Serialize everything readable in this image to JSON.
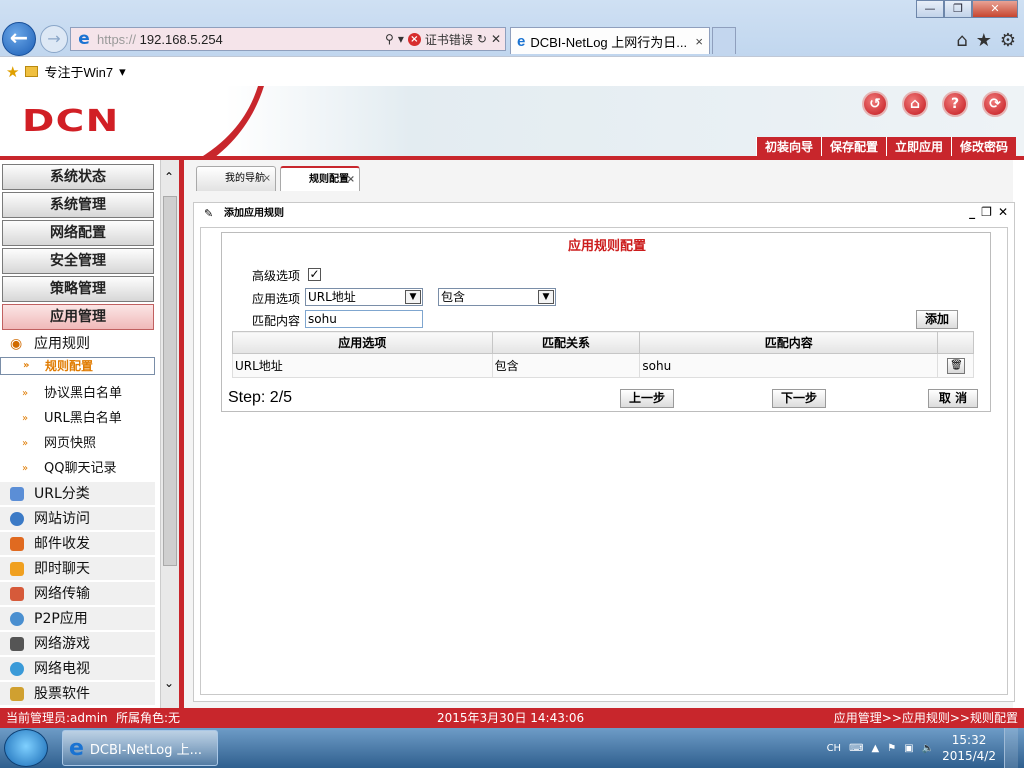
{
  "browser": {
    "url_scheme": "https://",
    "url_host": "192.168.5.254",
    "cert_error": "证书错误",
    "tab_title": "DCBI-NetLog 上网行为日...",
    "fav_item": "专注于Win7"
  },
  "app": {
    "logo": "DCN",
    "top_menu": [
      "初装向导",
      "保存配置",
      "立即应用",
      "修改密码"
    ]
  },
  "sidebar": {
    "groups": [
      "系统状态",
      "系统管理",
      "网络配置",
      "安全管理",
      "策略管理",
      "应用管理"
    ],
    "app_rule_header": "应用规则",
    "sub_items": [
      "规则配置",
      "协议黑白名单",
      "URL黑白名单",
      "网页快照",
      "QQ聊天记录"
    ],
    "categories": [
      "URL分类",
      "网站访问",
      "邮件收发",
      "即时聊天",
      "网络传输",
      "P2P应用",
      "网络游戏",
      "网络电视",
      "股票软件"
    ]
  },
  "tabs": [
    "我的导航",
    "规则配置"
  ],
  "panel": {
    "title": "添加应用规则",
    "form_title": "应用规则配置",
    "advanced_label": "高级选项",
    "app_option_label": "应用选项",
    "app_option_value": "URL地址",
    "relation_value": "包含",
    "match_label": "匹配内容",
    "match_value": "sohu",
    "add_button": "添加",
    "table_headers": [
      "应用选项",
      "匹配关系",
      "匹配内容"
    ],
    "rows": [
      {
        "option": "URL地址",
        "relation": "包含",
        "content": "sohu"
      }
    ],
    "step": "Step: 2/5",
    "prev_button": "上一步",
    "next_button": "下一步",
    "cancel_button": "取 消"
  },
  "status": {
    "admin": "当前管理员:admin",
    "role": "所属角色:无",
    "datetime": "2015年3月30日 14:43:06",
    "breadcrumb": "应用管理>>应用规则>>规则配置"
  },
  "taskbar": {
    "ie_label": "DCBI-NetLog 上...",
    "lang": "CH",
    "time": "15:32",
    "date": "2015/4/2"
  }
}
